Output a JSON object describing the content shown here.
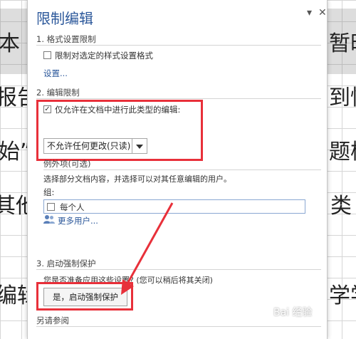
{
  "document": {
    "left_fragments": [
      "本",
      "报告",
      "始”",
      "其他",
      "编辑"
    ],
    "right_fragments": [
      "暂时",
      "到忧",
      "题样",
      "类",
      "学学"
    ]
  },
  "pane": {
    "title": "限制编辑",
    "dropdown_glyph": "▾",
    "close_glyph": "✕"
  },
  "section1": {
    "heading": "1. 格式设置限制",
    "checkbox_label": "限制对选定的样式设置格式",
    "settings_link": "设置..."
  },
  "section2": {
    "heading": "2. 编辑限制",
    "checkbox_label": "仅允许在文档中进行此类型的编辑:",
    "select_value": "不允许任何更改(只读)",
    "exceptions_heading": "例外项(可选)",
    "exceptions_desc": "选择部分文档内容，并选择可以对其任意编辑的用户。",
    "group_label": "组:",
    "group_item": "每个人",
    "more_users": "更多用户..."
  },
  "section3": {
    "heading": "3. 启动强制保护",
    "question": "您是否准备应用这些设置? (您可以稍后将其关闭)",
    "enforce_button": "是，启动强制保护"
  },
  "see_also": {
    "heading": "另请参阅"
  },
  "watermark": "Bai 经验",
  "colors": {
    "accent": "#2b579a",
    "highlight": "#e8303a"
  }
}
